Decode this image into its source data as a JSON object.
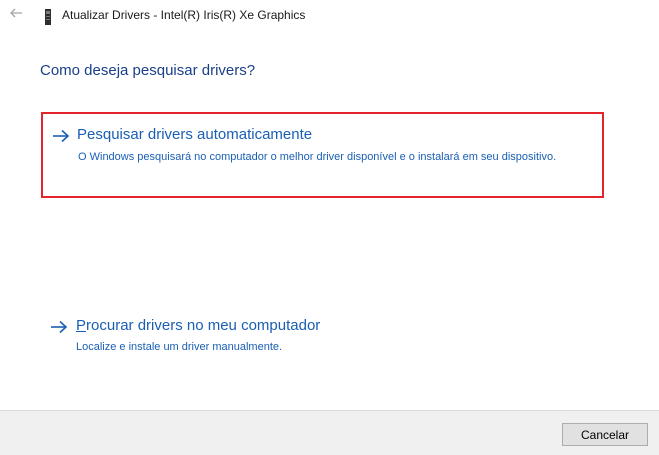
{
  "window": {
    "title": "Atualizar Drivers - Intel(R) Iris(R) Xe Graphics",
    "back_icon": "back-arrow-icon",
    "device_icon": "display-adapter-icon"
  },
  "main": {
    "heading": "Como deseja pesquisar drivers?",
    "options": [
      {
        "title": "Pesquisar drivers automaticamente",
        "description": "O Windows pesquisará no computador o melhor driver disponível e o instalará em seu dispositivo.",
        "icon": "right-arrow-icon",
        "highlighted": true
      },
      {
        "title_accel": "P",
        "title_rest": "rocurar drivers no meu computador",
        "description": "Localize e instale um driver manualmente.",
        "icon": "right-arrow-icon",
        "highlighted": false
      }
    ]
  },
  "footer": {
    "cancel_label": "Cancelar"
  },
  "colors": {
    "link_blue": "#1a5fb4",
    "heading_blue": "#1a3f8a",
    "highlight_red": "#e3252b",
    "footer_bg": "#f0f0f0"
  }
}
